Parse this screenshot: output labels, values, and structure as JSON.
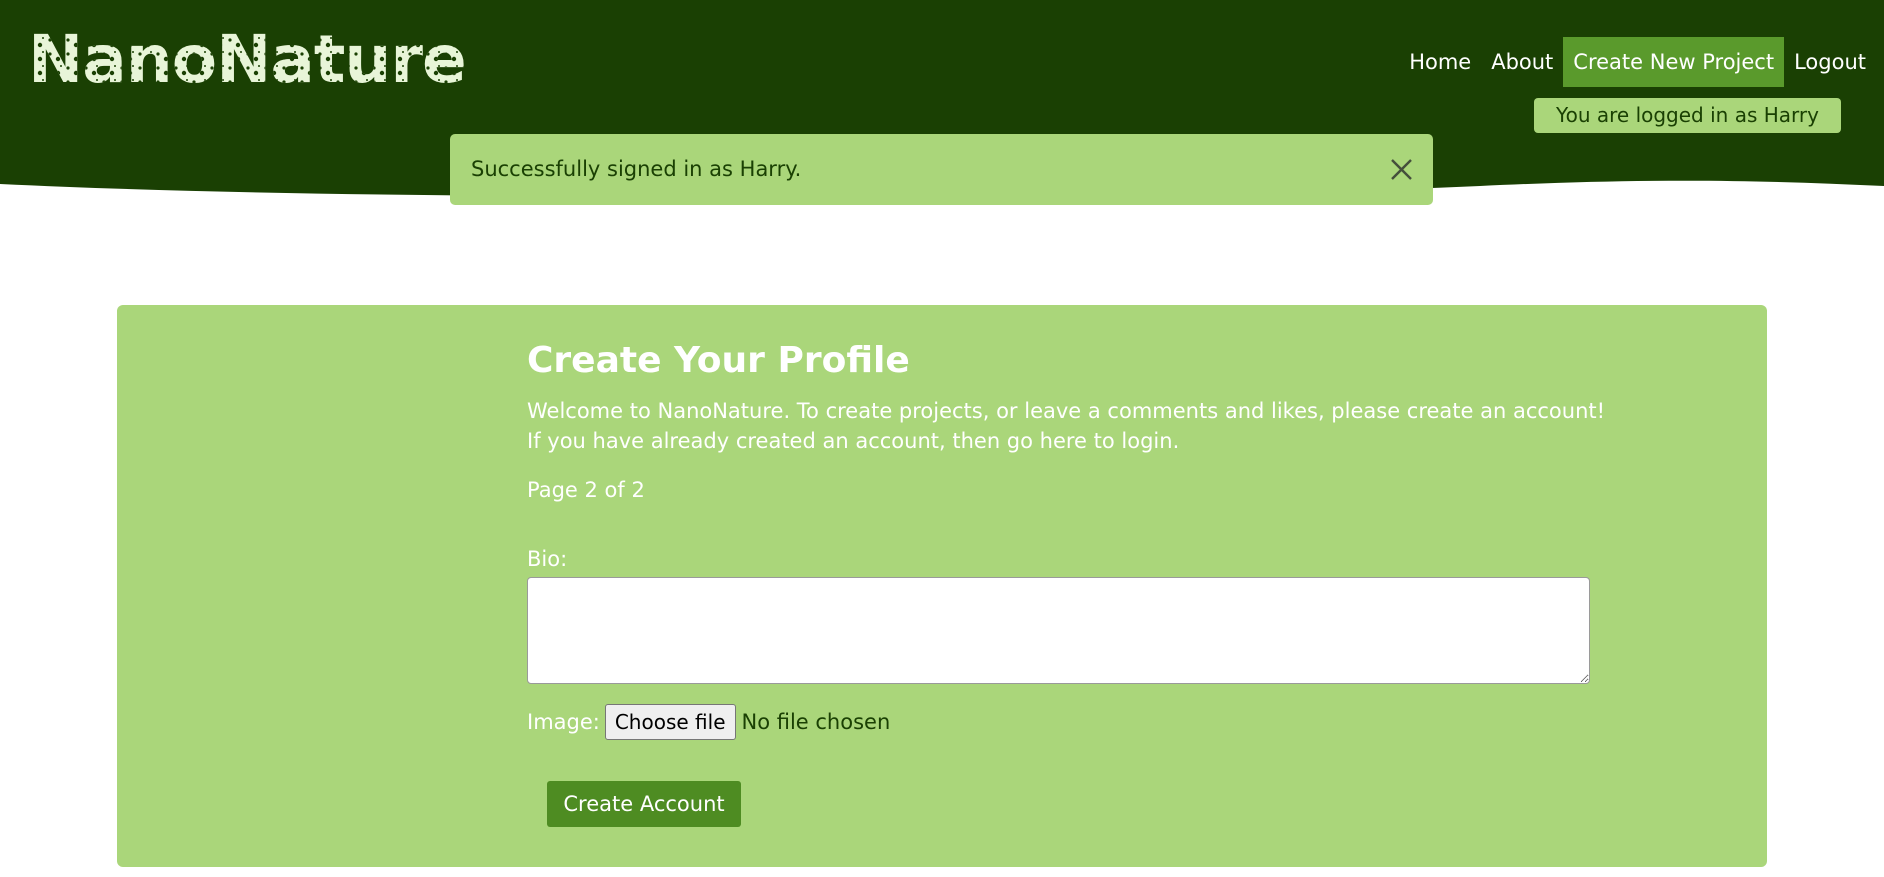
{
  "brand": {
    "name": "NanoNature",
    "header_color": "#1a4003",
    "accent_color": "#aad67a",
    "button_color": "#4e8c22"
  },
  "nav": {
    "items": [
      {
        "label": "Home",
        "active": false
      },
      {
        "label": "About",
        "active": false
      },
      {
        "label": "Create New Project",
        "active": true
      },
      {
        "label": "Logout",
        "active": false
      }
    ]
  },
  "user_status": "You are logged in as Harry",
  "alert": {
    "message": "Successfully signed in as Harry.",
    "close_icon": "close-icon"
  },
  "form": {
    "title": "Create Your Profile",
    "description_line1": "Welcome to NanoNature. To create projects, or leave a comments and likes, please create an account!",
    "description_line2": "If you have already created an account, then go here to login.",
    "page_indicator": "Page 2 of 2",
    "bio_label": "Bio:",
    "bio_value": "",
    "image_label": "Image:",
    "file_button_label": "Choose file",
    "file_status": "No file chosen",
    "submit_label": "Create Account"
  }
}
